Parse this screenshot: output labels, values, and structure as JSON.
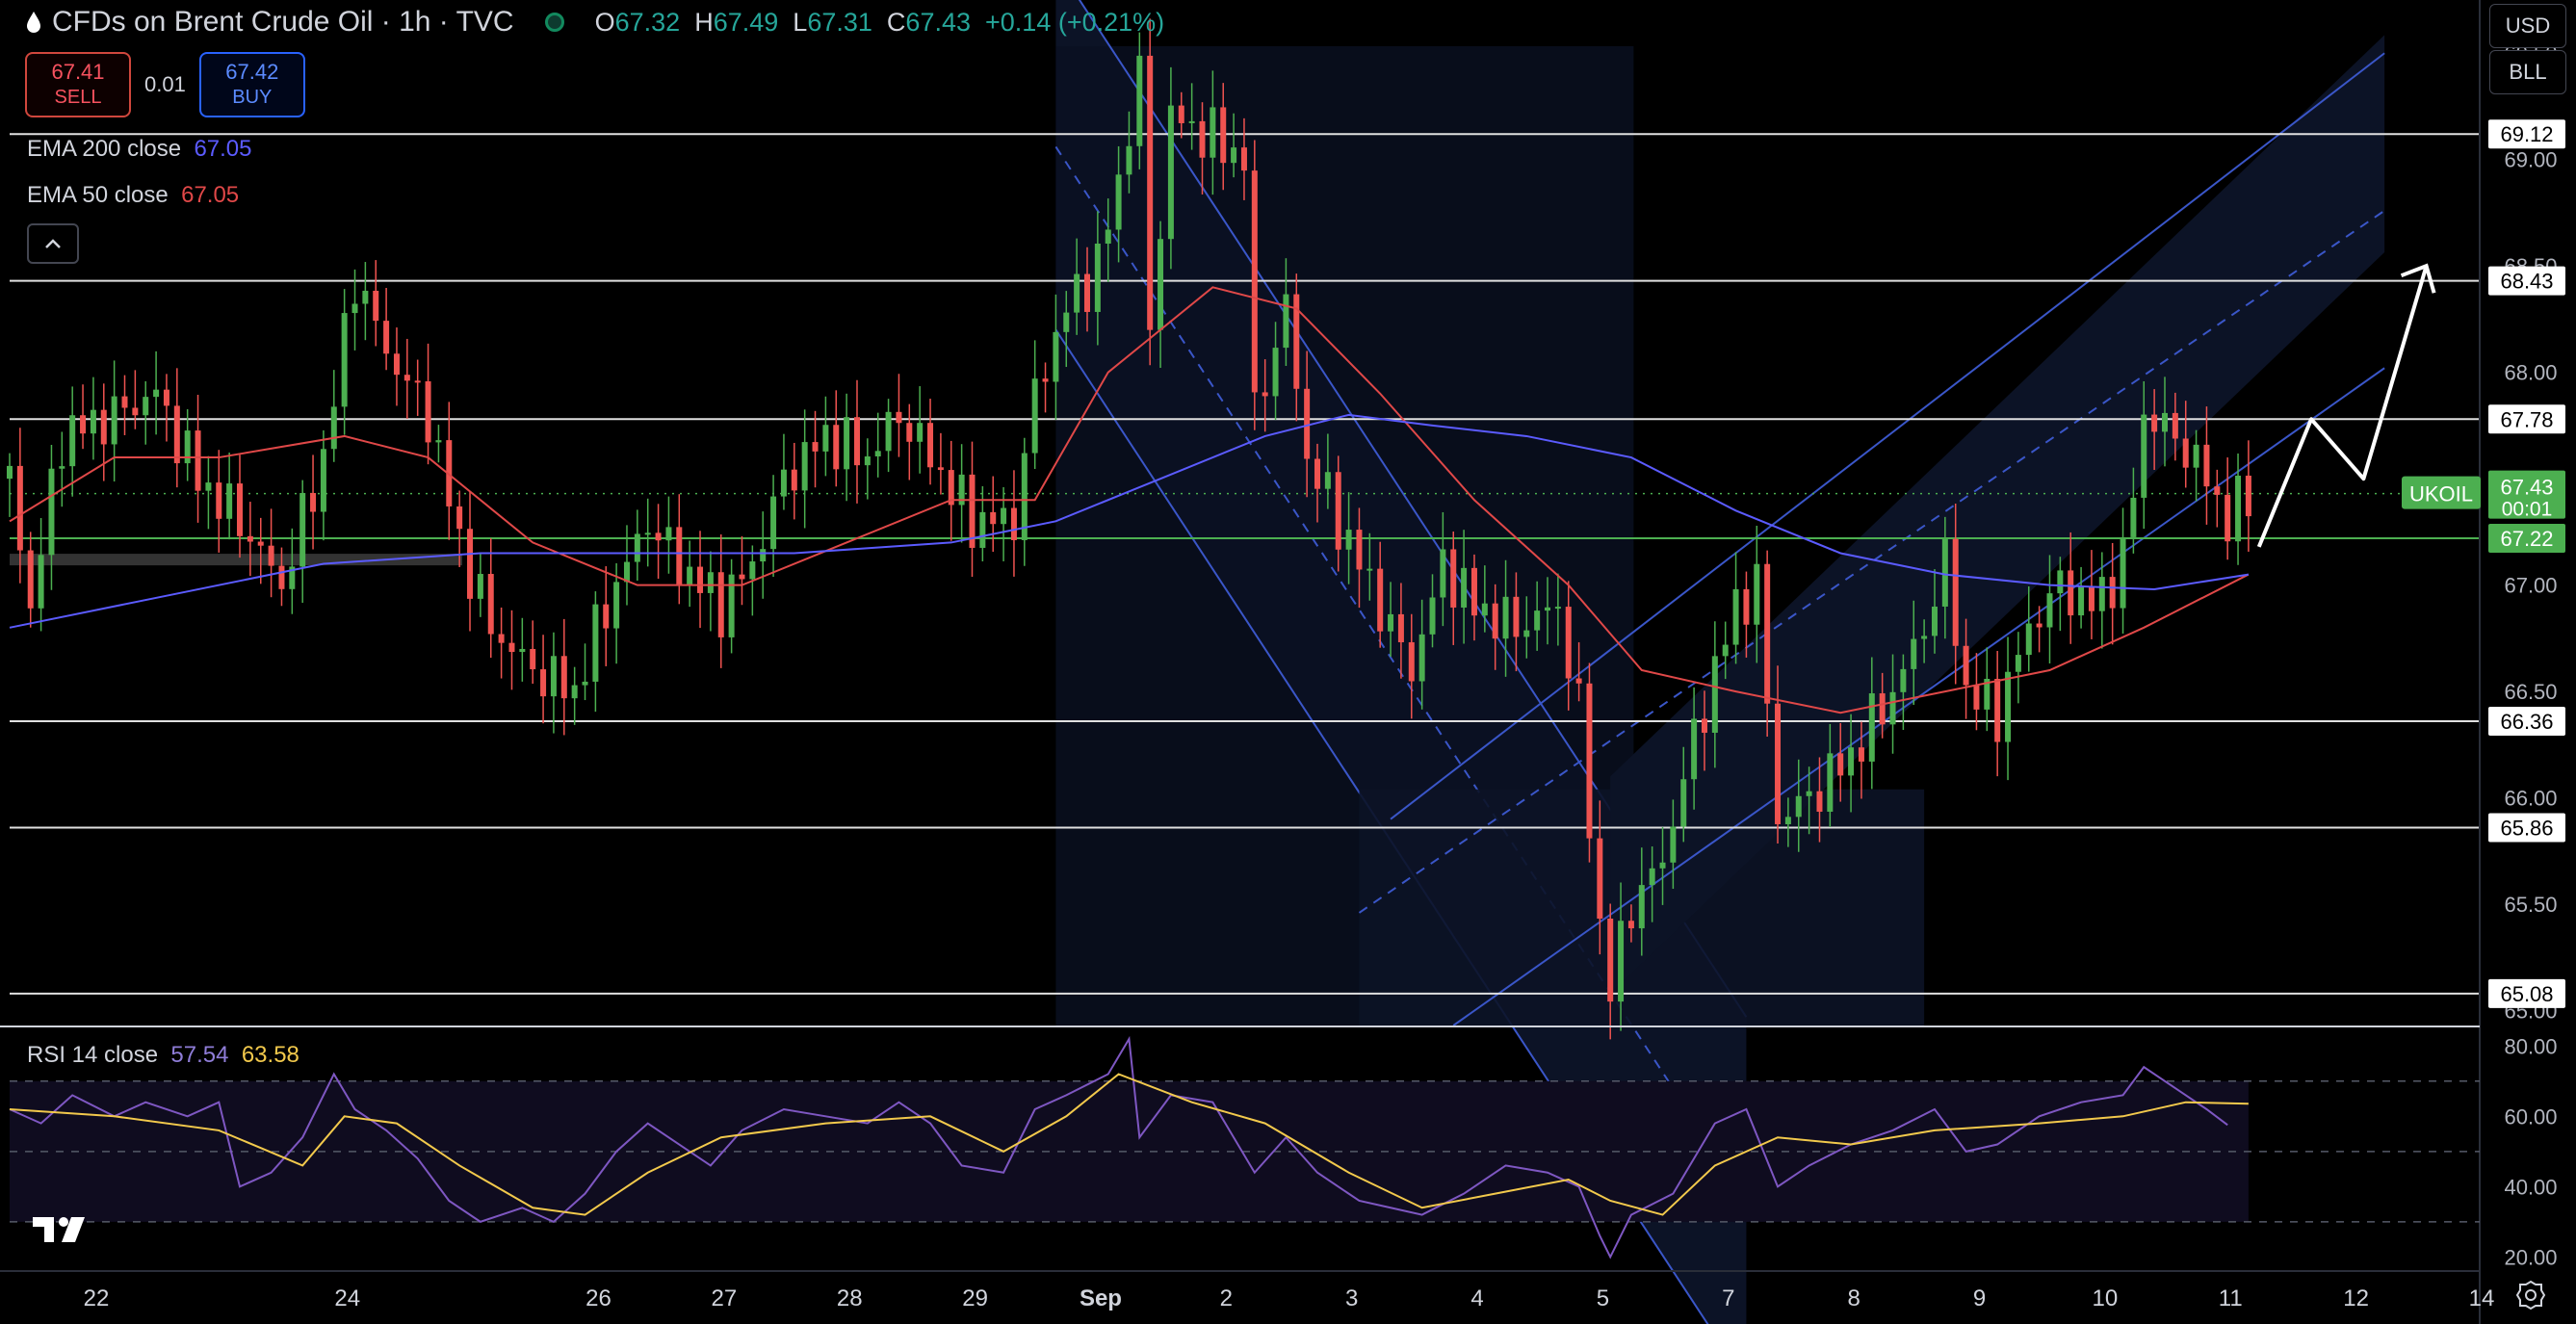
{
  "header": {
    "title": "CFDs on Brent Crude Oil · 1h · TVC",
    "open_label": "O",
    "open": "67.32",
    "high_label": "H",
    "high": "67.49",
    "low_label": "L",
    "low": "67.31",
    "close_label": "C",
    "close": "67.43",
    "change": "+0.14 (+0.21%)"
  },
  "trade": {
    "sell_price": "67.41",
    "sell_label": "SELL",
    "spread": "0.01",
    "buy_price": "67.42",
    "buy_label": "BUY"
  },
  "indicators": {
    "ema200_label": "EMA 200 close",
    "ema200_value": "67.05",
    "ema200_color": "#5b5bff",
    "ema50_label": "EMA 50 close",
    "ema50_value": "67.05",
    "ema50_color": "#e04848"
  },
  "rsi": {
    "label": "RSI 14 close",
    "value": "57.54",
    "ma_value": "63.58",
    "color": "#7e57c2",
    "ma_color": "#f2c94c"
  },
  "toolbar": {
    "currency": "USD",
    "unit": "BLL",
    "collapse_icon": "chevron-up-icon",
    "settings_icon": "gear-icon"
  },
  "chart_data": {
    "type": "candlestick",
    "symbol_label": "UKOIL",
    "current_price": "67.43",
    "countdown": "00:01",
    "x_ticks": [
      {
        "label": "22",
        "x": 0
      },
      {
        "label": "24",
        "x": 48
      },
      {
        "label": "26",
        "x": 96
      },
      {
        "label": "27",
        "x": 120
      },
      {
        "label": "28",
        "x": 144
      },
      {
        "label": "29",
        "x": 168
      },
      {
        "label": "Sep",
        "x": 192
      },
      {
        "label": "2",
        "x": 216
      },
      {
        "label": "3",
        "x": 240
      },
      {
        "label": "4",
        "x": 264
      },
      {
        "label": "5",
        "x": 288
      },
      {
        "label": "7",
        "x": 312
      },
      {
        "label": "8",
        "x": 336
      },
      {
        "label": "9",
        "x": 360
      },
      {
        "label": "10",
        "x": 384
      },
      {
        "label": "11",
        "x": 408
      },
      {
        "label": "12",
        "x": 432
      },
      {
        "label": "14",
        "x": 456
      }
    ],
    "y_ticks": [
      "65.00",
      "65.50",
      "66.00",
      "66.50",
      "67.00",
      "67.50",
      "68.00",
      "68.50",
      "69.00",
      "69.50"
    ],
    "ylim": [
      64.93,
      69.75
    ],
    "horizontal_levels": [
      "69.12",
      "68.43",
      "67.78",
      "67.22",
      "66.36",
      "65.86",
      "65.08"
    ],
    "price_path": [
      [
        0,
        67.5
      ],
      [
        4,
        66.9
      ],
      [
        10,
        67.7
      ],
      [
        20,
        67.8
      ],
      [
        28,
        67.9
      ],
      [
        36,
        67.5
      ],
      [
        44,
        67.3
      ],
      [
        52,
        67.0
      ],
      [
        60,
        67.6
      ],
      [
        66,
        68.45
      ],
      [
        72,
        68.1
      ],
      [
        80,
        67.8
      ],
      [
        86,
        67.2
      ],
      [
        92,
        66.8
      ],
      [
        100,
        66.6
      ],
      [
        108,
        66.5
      ],
      [
        114,
        66.9
      ],
      [
        122,
        67.3
      ],
      [
        128,
        67.1
      ],
      [
        136,
        66.9
      ],
      [
        142,
        67.1
      ],
      [
        148,
        67.5
      ],
      [
        156,
        67.7
      ],
      [
        164,
        67.6
      ],
      [
        170,
        67.8
      ],
      [
        176,
        67.6
      ],
      [
        184,
        67.3
      ],
      [
        192,
        67.3
      ],
      [
        196,
        67.9
      ],
      [
        202,
        68.3
      ],
      [
        208,
        68.5
      ],
      [
        212,
        68.9
      ],
      [
        216,
        69.4
      ],
      [
        218,
        68.2
      ],
      [
        222,
        69.2
      ],
      [
        230,
        69.1
      ],
      [
        236,
        69.0
      ],
      [
        238,
        67.8
      ],
      [
        244,
        68.3
      ],
      [
        248,
        67.6
      ],
      [
        256,
        67.2
      ],
      [
        262,
        66.9
      ],
      [
        268,
        66.6
      ],
      [
        274,
        67.1
      ],
      [
        280,
        66.9
      ],
      [
        288,
        66.8
      ],
      [
        296,
        66.9
      ],
      [
        300,
        66.4
      ],
      [
        304,
        65.4
      ],
      [
        306,
        65.1
      ],
      [
        310,
        65.5
      ],
      [
        316,
        65.7
      ],
      [
        320,
        66.1
      ],
      [
        326,
        66.6
      ],
      [
        330,
        66.9
      ],
      [
        334,
        67.0
      ],
      [
        338,
        65.9
      ],
      [
        344,
        66.0
      ],
      [
        352,
        66.2
      ],
      [
        360,
        66.5
      ],
      [
        366,
        66.8
      ],
      [
        370,
        67.1
      ],
      [
        374,
        66.5
      ],
      [
        380,
        66.4
      ],
      [
        386,
        66.8
      ],
      [
        392,
        67.0
      ],
      [
        398,
        66.9
      ],
      [
        404,
        67.1
      ],
      [
        408,
        67.8
      ],
      [
        414,
        67.7
      ],
      [
        420,
        67.5
      ],
      [
        424,
        67.3
      ],
      [
        428,
        67.43
      ]
    ],
    "ema50": [
      [
        0,
        67.3
      ],
      [
        20,
        67.6
      ],
      [
        40,
        67.6
      ],
      [
        64,
        67.7
      ],
      [
        80,
        67.6
      ],
      [
        100,
        67.2
      ],
      [
        120,
        67.0
      ],
      [
        140,
        67.0
      ],
      [
        160,
        67.2
      ],
      [
        180,
        67.4
      ],
      [
        196,
        67.4
      ],
      [
        210,
        68.0
      ],
      [
        230,
        68.4
      ],
      [
        246,
        68.3
      ],
      [
        262,
        67.9
      ],
      [
        280,
        67.4
      ],
      [
        298,
        67.0
      ],
      [
        312,
        66.6
      ],
      [
        330,
        66.5
      ],
      [
        350,
        66.4
      ],
      [
        370,
        66.5
      ],
      [
        390,
        66.6
      ],
      [
        408,
        66.8
      ],
      [
        428,
        67.05
      ]
    ],
    "ema200": [
      [
        0,
        66.8
      ],
      [
        30,
        66.95
      ],
      [
        60,
        67.1
      ],
      [
        90,
        67.15
      ],
      [
        120,
        67.15
      ],
      [
        150,
        67.15
      ],
      [
        180,
        67.2
      ],
      [
        200,
        67.3
      ],
      [
        220,
        67.5
      ],
      [
        240,
        67.7
      ],
      [
        256,
        67.8
      ],
      [
        272,
        67.75
      ],
      [
        290,
        67.7
      ],
      [
        310,
        67.6
      ],
      [
        330,
        67.35
      ],
      [
        350,
        67.15
      ],
      [
        370,
        67.05
      ],
      [
        390,
        67.0
      ],
      [
        410,
        66.98
      ],
      [
        428,
        67.05
      ]
    ],
    "rsi_ticks": [
      "20.00",
      "40.00",
      "60.00",
      "80.00"
    ],
    "rsi_ylim": [
      16,
      85
    ],
    "rsi_levels": [
      30,
      50,
      70
    ],
    "rsi_path": [
      [
        0,
        62
      ],
      [
        6,
        58
      ],
      [
        12,
        66
      ],
      [
        20,
        60
      ],
      [
        26,
        64
      ],
      [
        34,
        60
      ],
      [
        40,
        64
      ],
      [
        44,
        40
      ],
      [
        50,
        44
      ],
      [
        56,
        54
      ],
      [
        62,
        72
      ],
      [
        66,
        62
      ],
      [
        72,
        56
      ],
      [
        78,
        48
      ],
      [
        84,
        36
      ],
      [
        90,
        30
      ],
      [
        98,
        34
      ],
      [
        104,
        30
      ],
      [
        110,
        38
      ],
      [
        116,
        50
      ],
      [
        122,
        58
      ],
      [
        128,
        52
      ],
      [
        134,
        46
      ],
      [
        140,
        56
      ],
      [
        148,
        62
      ],
      [
        156,
        60
      ],
      [
        164,
        58
      ],
      [
        170,
        64
      ],
      [
        176,
        58
      ],
      [
        182,
        46
      ],
      [
        190,
        44
      ],
      [
        196,
        62
      ],
      [
        202,
        66
      ],
      [
        210,
        72
      ],
      [
        214,
        82
      ],
      [
        216,
        54
      ],
      [
        222,
        66
      ],
      [
        230,
        64
      ],
      [
        238,
        44
      ],
      [
        244,
        54
      ],
      [
        250,
        44
      ],
      [
        258,
        36
      ],
      [
        264,
        34
      ],
      [
        270,
        32
      ],
      [
        278,
        38
      ],
      [
        286,
        46
      ],
      [
        294,
        44
      ],
      [
        300,
        40
      ],
      [
        304,
        26
      ],
      [
        306,
        20
      ],
      [
        310,
        32
      ],
      [
        318,
        38
      ],
      [
        326,
        58
      ],
      [
        332,
        62
      ],
      [
        338,
        40
      ],
      [
        344,
        46
      ],
      [
        352,
        52
      ],
      [
        360,
        56
      ],
      [
        368,
        62
      ],
      [
        374,
        50
      ],
      [
        380,
        52
      ],
      [
        388,
        60
      ],
      [
        396,
        64
      ],
      [
        404,
        66
      ],
      [
        408,
        74
      ],
      [
        414,
        68
      ],
      [
        420,
        62
      ],
      [
        424,
        57.54
      ]
    ],
    "rsi_ma_path": [
      [
        0,
        62
      ],
      [
        20,
        60
      ],
      [
        40,
        56
      ],
      [
        56,
        46
      ],
      [
        64,
        60
      ],
      [
        74,
        58
      ],
      [
        86,
        46
      ],
      [
        100,
        34
      ],
      [
        110,
        32
      ],
      [
        122,
        44
      ],
      [
        136,
        54
      ],
      [
        156,
        58
      ],
      [
        176,
        60
      ],
      [
        190,
        50
      ],
      [
        202,
        60
      ],
      [
        212,
        72
      ],
      [
        226,
        64
      ],
      [
        240,
        58
      ],
      [
        256,
        44
      ],
      [
        270,
        34
      ],
      [
        284,
        38
      ],
      [
        298,
        42
      ],
      [
        306,
        36
      ],
      [
        316,
        32
      ],
      [
        326,
        46
      ],
      [
        338,
        54
      ],
      [
        352,
        52
      ],
      [
        368,
        56
      ],
      [
        388,
        58
      ],
      [
        404,
        60
      ],
      [
        416,
        64
      ],
      [
        428,
        63.58
      ]
    ],
    "down_channel": {
      "x_start": 200,
      "x_end": 332
    },
    "up_channel": {
      "x_start": 306,
      "x_end": 454
    },
    "projection_arrow": [
      [
        430,
        67.18
      ],
      [
        440,
        67.78
      ],
      [
        450,
        67.5
      ],
      [
        462,
        68.5
      ]
    ]
  }
}
